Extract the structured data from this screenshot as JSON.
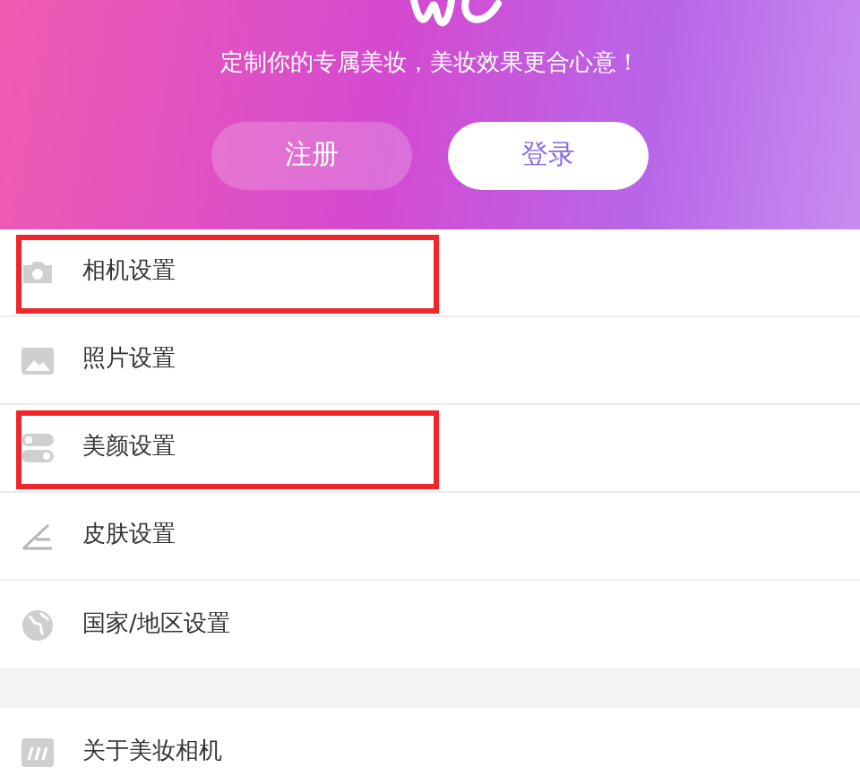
{
  "header": {
    "tagline": "定制你的专属美妆，美妆效果更合心意！",
    "buttons": [
      {
        "label": "注册",
        "kind": "ghost"
      },
      {
        "label": "登录",
        "kind": "solid"
      }
    ]
  },
  "settings": [
    {
      "label": "相机设置",
      "highlighted": true
    },
    {
      "label": "照片设置",
      "highlighted": false
    },
    {
      "label": "美颜设置",
      "highlighted": true
    },
    {
      "label": "皮肤设置",
      "highlighted": false
    },
    {
      "label": "国家/地区设置",
      "highlighted": false
    }
  ],
  "about": [
    {
      "label": "关于美妆相机",
      "highlighted": false
    }
  ]
}
